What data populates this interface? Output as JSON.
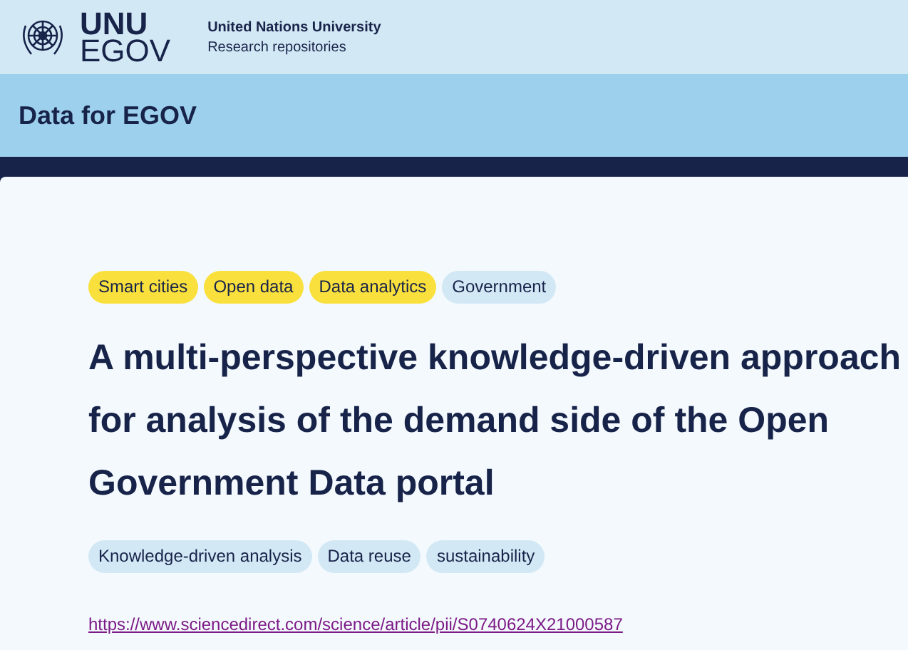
{
  "header": {
    "logo_top": "UNU",
    "logo_bottom": "EGOV",
    "org": "United Nations University",
    "subtitle": "Research repositories"
  },
  "site_title": "Data for EGOV",
  "categories": [
    {
      "label": "Smart cities",
      "color": "#fae03c"
    },
    {
      "label": "Open data",
      "color": "#fae03c"
    },
    {
      "label": "Data analytics",
      "color": "#fae03c"
    },
    {
      "label": "Government",
      "color": "#d2e8f5"
    }
  ],
  "title": "A multi-perspective knowledge-driven approach for analysis of the demand side of the Open Government Data portal",
  "keywords": [
    "Knowledge-driven analysis",
    "Data reuse",
    "sustainability"
  ],
  "link": "https://www.sciencedirect.com/science/article/pii/S0740624X21000587"
}
